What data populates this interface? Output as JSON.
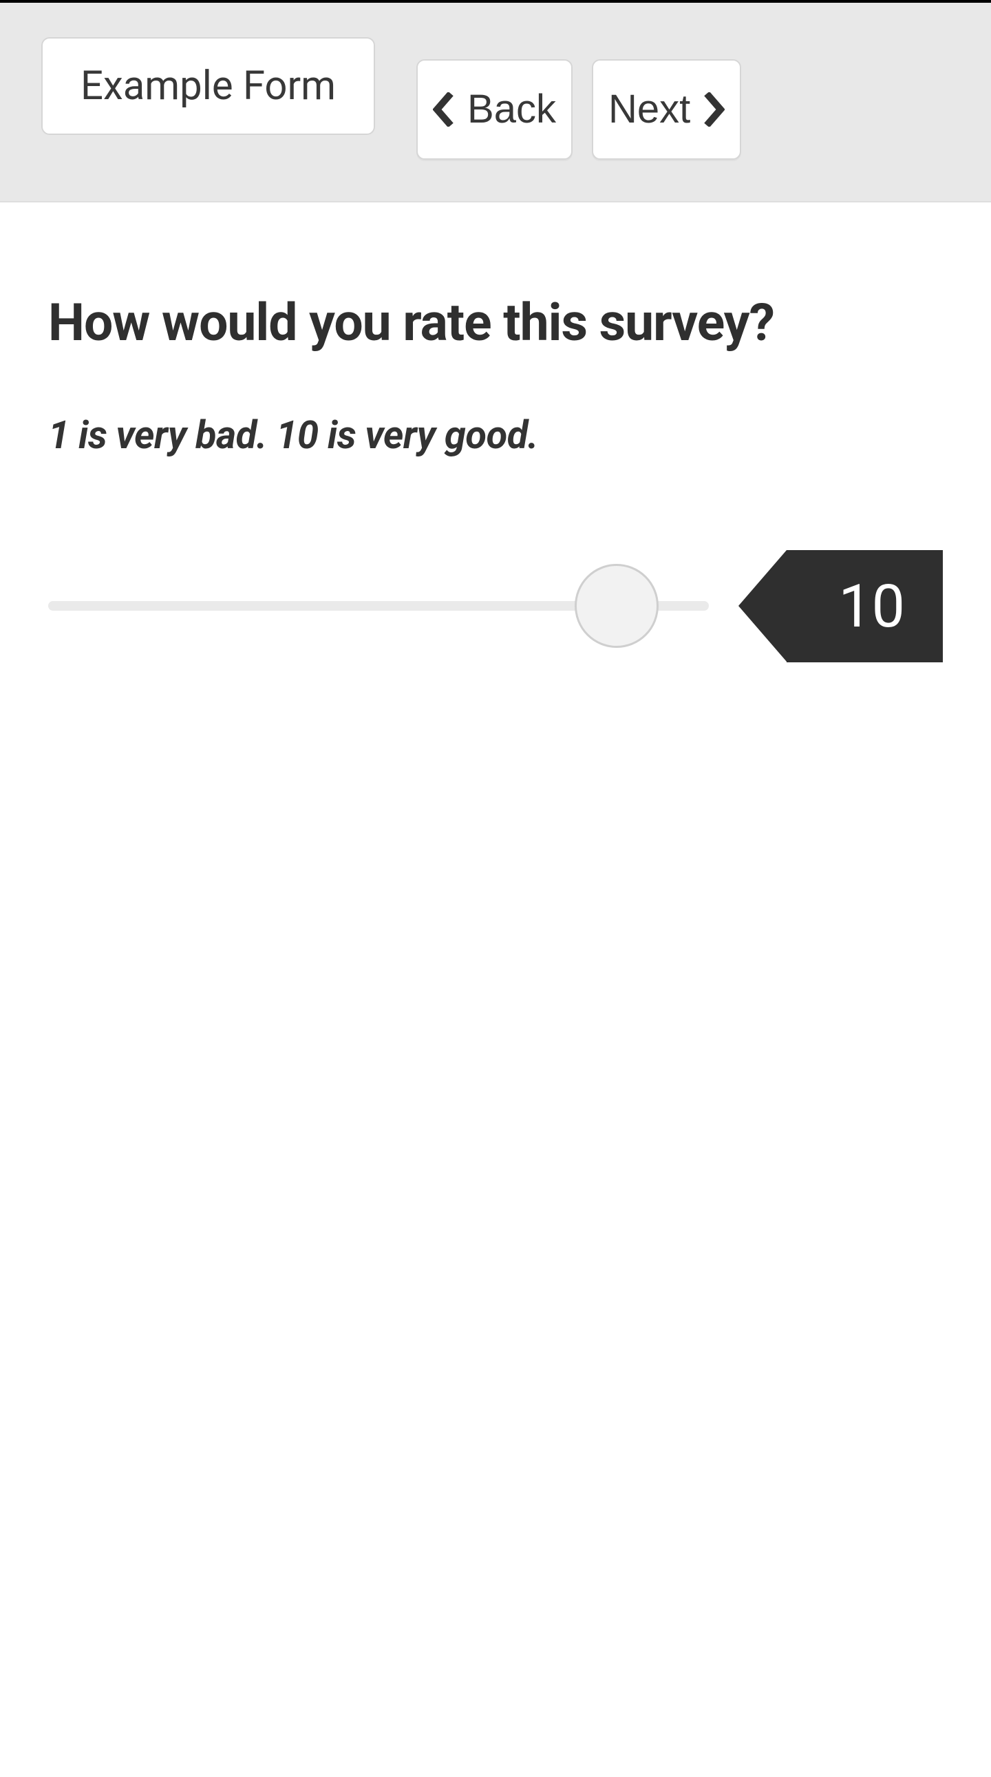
{
  "header": {
    "form_title": "Example Form",
    "back_label": "Back",
    "next_label": "Next"
  },
  "question": {
    "title": "How would you rate this survey?",
    "subtitle": "1 is very bad. 10 is very good."
  },
  "slider": {
    "min": 1,
    "max": 10,
    "value_display": "10",
    "thumb_position_percent": 86
  }
}
